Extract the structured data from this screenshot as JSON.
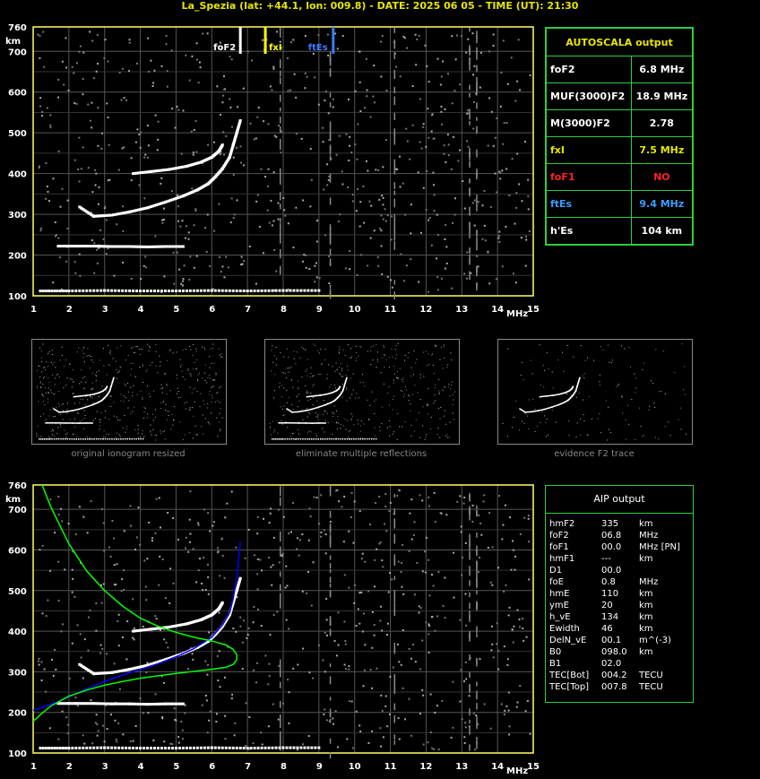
{
  "header": "La_Spezia (lat: +44.1, lon: 009.8) - DATE: 2025 06 05 - TIME (UT): 21:30",
  "chart_data": [
    {
      "type": "scatter",
      "title": "",
      "xlabel": "MHz",
      "ylabel": "km",
      "xlim": [
        1,
        15
      ],
      "ylim": [
        100,
        760
      ],
      "xticks": [
        "1",
        "2",
        "3",
        "4",
        "5",
        "6",
        "7",
        "8",
        "9",
        "10",
        "11",
        "12",
        "13",
        "14",
        "15"
      ],
      "yticks": [
        "100",
        "200",
        "300",
        "400",
        "500",
        "600",
        "700",
        "760"
      ],
      "grid": true,
      "markers": [
        {
          "label": "foF2",
          "x": 6.8,
          "color": "#ffffff"
        },
        {
          "label": "fxI",
          "x": 7.5,
          "color": "#ffff00"
        },
        {
          "label": "ftEs",
          "x": 9.4,
          "color": "#3a7dff"
        }
      ],
      "series": [
        {
          "name": "",
          "x": [
            2.3,
            2.7,
            3.2,
            3.7,
            4.2,
            4.7,
            5.2,
            5.6,
            5.9,
            6.1,
            6.3,
            6.5,
            6.6,
            6.7,
            6.8
          ],
          "y": [
            318,
            295,
            298,
            306,
            316,
            330,
            345,
            360,
            375,
            392,
            412,
            440,
            470,
            500,
            530
          ]
        },
        {
          "name": "",
          "x": [
            3.8,
            4.3,
            4.8,
            5.3,
            5.7,
            6.0,
            6.2,
            6.3
          ],
          "y": [
            400,
            405,
            410,
            418,
            428,
            440,
            455,
            470
          ]
        },
        {
          "name": "",
          "x": [
            1.2,
            2,
            3,
            4,
            5,
            6,
            7,
            8,
            9
          ],
          "y": [
            112,
            112,
            113,
            112,
            112,
            113,
            112,
            113,
            113
          ]
        },
        {
          "name": "",
          "x": [
            1.7,
            2.2,
            2.7,
            3.2,
            3.7,
            4.2,
            4.7,
            5.2
          ],
          "y": [
            222,
            222,
            222,
            221,
            221,
            220,
            221,
            221
          ]
        }
      ]
    },
    {
      "type": "line",
      "title": "",
      "xlabel": "MHz",
      "ylabel": "km",
      "xlim": [
        1,
        15
      ],
      "ylim": [
        100,
        760
      ],
      "grid": true,
      "series": [
        {
          "name": "",
          "color": "#0000ff",
          "x": [
            1.0,
            1.5,
            2.0,
            2.5,
            3.0,
            3.5,
            4.0,
            4.5,
            5.0,
            5.5,
            6.0,
            6.3,
            6.5,
            6.6,
            6.7,
            6.8
          ],
          "y": [
            205,
            220,
            238,
            258,
            276,
            292,
            306,
            320,
            337,
            357,
            385,
            415,
            445,
            480,
            530,
            620
          ]
        },
        {
          "name": "",
          "color": "#00ff00",
          "x": [
            1.25,
            1.5,
            2,
            2.5,
            3,
            3.5,
            4,
            4.5,
            5,
            5.5,
            6,
            6.4,
            6.6,
            6.7,
            6.7,
            6.6,
            6.4,
            6.0,
            5.5,
            5.0,
            4.5,
            4.0,
            3.5,
            3.0,
            2.5,
            2.0,
            1.5,
            1.25,
            1.0
          ],
          "y": [
            760,
            705,
            615,
            548,
            500,
            462,
            432,
            412,
            397,
            385,
            376,
            366,
            355,
            342,
            330,
            318,
            311,
            306,
            301,
            296,
            290,
            284,
            276,
            267,
            255,
            240,
            216,
            198,
            178
          ]
        }
      ]
    }
  ],
  "autoscala": {
    "title": "AUTOSCALA output",
    "rows": [
      {
        "label": "foF2",
        "value": "6.8 MHz",
        "color": "#ffffff"
      },
      {
        "label": "MUF(3000)F2",
        "value": "18.9 MHz",
        "color": "#ffffff"
      },
      {
        "label": "M(3000)F2",
        "value": "2.78",
        "color": "#ffffff"
      },
      {
        "label": "fxI",
        "value": "7.5 MHz",
        "color": "#e6e600"
      },
      {
        "label": "foF1",
        "value": "NO",
        "color": "#ff2020"
      },
      {
        "label": "ftEs",
        "value": "9.4 MHz",
        "color": "#3a9dff"
      },
      {
        "label": "h'Es",
        "value": "104     km",
        "color": "#ffffff"
      }
    ]
  },
  "thumbnails": [
    {
      "caption": "original ionogram resized"
    },
    {
      "caption": "eliminate multiple reflections"
    },
    {
      "caption": "evidence F2 trace"
    }
  ],
  "aip": {
    "title": "AIP output",
    "rows": [
      {
        "name": "hmF2",
        "value": "335",
        "unit": "km"
      },
      {
        "name": "foF2",
        "value": "06.8",
        "unit": "MHz"
      },
      {
        "name": "foF1",
        "value": "00.0",
        "unit": "MHz   [PN]"
      },
      {
        "name": "hmF1",
        "value": "---",
        "unit": "km"
      },
      {
        "name": "D1",
        "value": "00.0",
        "unit": ""
      },
      {
        "name": "foE",
        "value": "0.8",
        "unit": "MHz"
      },
      {
        "name": "hmE",
        "value": "110",
        "unit": "km"
      },
      {
        "name": "ymE",
        "value": "20",
        "unit": "km"
      },
      {
        "name": "h_vE",
        "value": "134",
        "unit": "km"
      },
      {
        "name": "Ewidth",
        "value": "46",
        "unit": "km"
      },
      {
        "name": "DelN_vE",
        "value": "00.1",
        "unit": "m^(-3)"
      },
      {
        "name": "B0",
        "value": "098.0",
        "unit": "km"
      },
      {
        "name": "B1",
        "value": "02.0",
        "unit": ""
      },
      {
        "name": "TEC[Bot]",
        "value": "004.2",
        "unit": "TECU"
      },
      {
        "name": "TEC[Top]",
        "value": "007.8",
        "unit": "TECU"
      }
    ]
  }
}
